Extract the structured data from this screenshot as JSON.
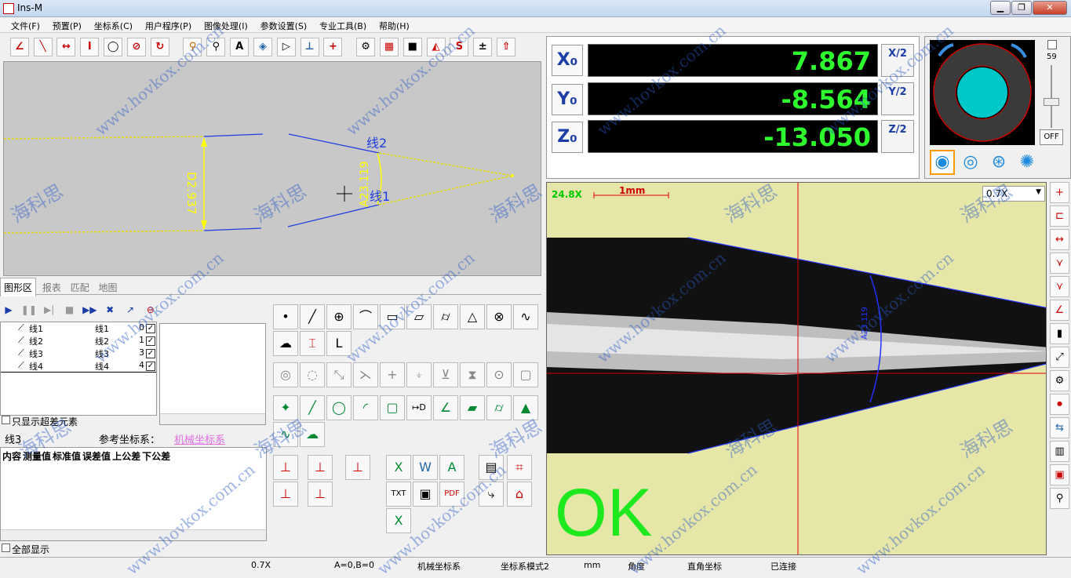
{
  "window": {
    "title": "Ins-M",
    "min": "▁",
    "max": "❐",
    "close": "✕"
  },
  "menu": [
    "文件(F)",
    "预置(P)",
    "坐标系(C)",
    "用户程序(P)",
    "图像处理(I)",
    "参数设置(S)",
    "专业工具(B)",
    "帮助(H)"
  ],
  "graph": {
    "label_line2": "线2",
    "label_line1": "线1",
    "dim_d": "D2.937",
    "dim_a": "A23.119"
  },
  "dro": {
    "x": {
      "label": "X₀",
      "value": "7.867",
      "half": "X/2"
    },
    "y": {
      "label": "Y₀",
      "value": "-8.564",
      "half": "Y/2"
    },
    "z": {
      "label": "Z₀",
      "value": "-13.050",
      "half": "Z/2"
    }
  },
  "light": {
    "level": "59",
    "off": "OFF",
    "level_fraction": 0.59
  },
  "camera": {
    "zoom": "24.8X",
    "scale": "1mm",
    "zoom_select": "0.7X",
    "result": "OK",
    "angle_label": "A23.119"
  },
  "tabs": [
    "图形区",
    "报表",
    "匹配",
    "地图"
  ],
  "program": {
    "rows": [
      {
        "name": "线1",
        "ref": "线1",
        "n": "0",
        "checked": true
      },
      {
        "name": "线2",
        "ref": "线2",
        "n": "1",
        "checked": true
      },
      {
        "name": "线3",
        "ref": "线3",
        "n": "3",
        "checked": true
      },
      {
        "name": "线4",
        "ref": "线4",
        "n": "4",
        "checked": true
      }
    ],
    "only_exceed": "只显示超差元素"
  },
  "results": {
    "current": "线3",
    "ref_label": "参考坐标系：",
    "ref_value": "机械坐标系",
    "columns": [
      "内容",
      "测量值",
      "标准值",
      "误差值",
      "上公差",
      "下公差"
    ],
    "show_all": "全部显示"
  },
  "status": {
    "zoom": "0.7X",
    "ab": "A=0,B=0",
    "coord": "机械坐标系",
    "mode": "坐标系模式2",
    "unit": "mm",
    "angle": "角度",
    "rect": "直角坐标",
    "conn": "已连接"
  },
  "watermark": {
    "url": "www.hovkox.com.cn",
    "cn": "海科思"
  }
}
